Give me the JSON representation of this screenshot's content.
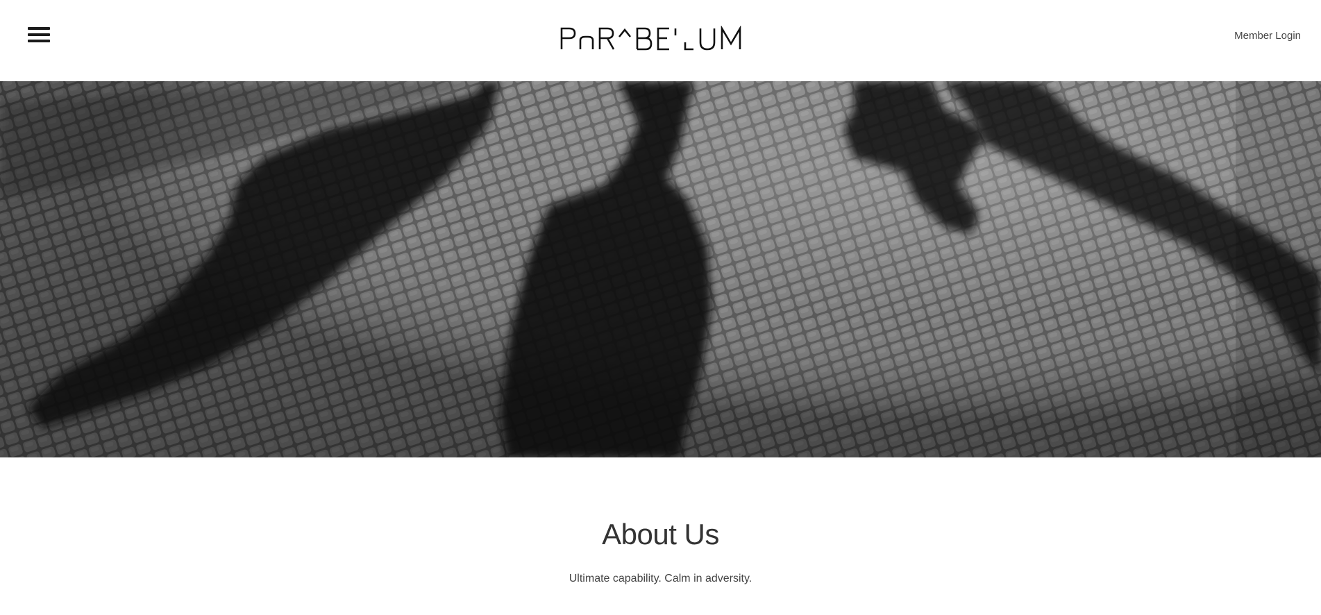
{
  "header": {
    "menu_icon": "hamburger-menu-icon",
    "brand": "PARABELLUM",
    "member_login": "Member Login"
  },
  "hero": {
    "image": "black-and-white cobblestone street with long shadows of pedestrians"
  },
  "about": {
    "title": "About Us",
    "tagline": "Ultimate capability. Calm in adversity."
  },
  "colors": {
    "text": "#333333",
    "background": "#ffffff",
    "icon": "#1a1a1a"
  }
}
